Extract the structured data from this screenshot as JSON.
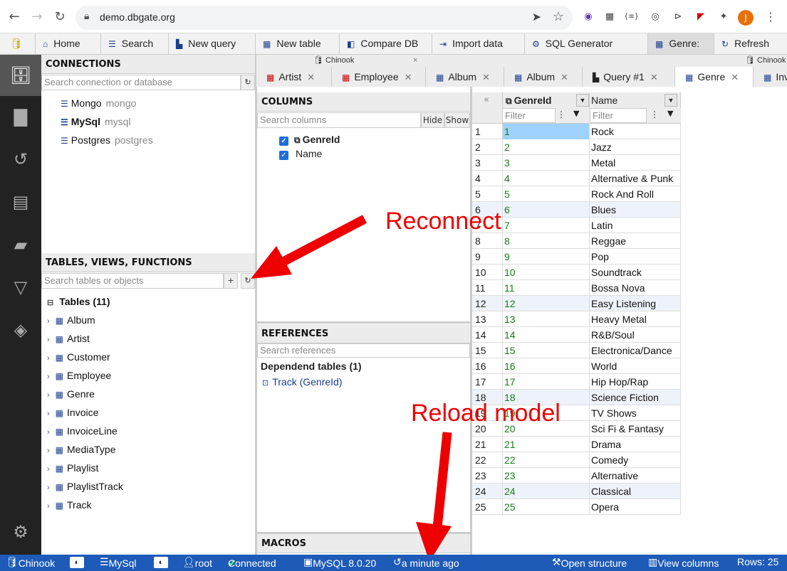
{
  "browser": {
    "url": "demo.dbgate.org",
    "avatar": "J"
  },
  "toolbar": {
    "items": [
      "Home",
      "Search",
      "New query",
      "New table",
      "Compare DB",
      "Import data",
      "SQL Generator",
      "Genre:",
      "Refresh"
    ]
  },
  "connections": {
    "title": "CONNECTIONS",
    "search_placeholder": "Search connection or database",
    "items": [
      {
        "name": "Mongo",
        "sub": "mongo"
      },
      {
        "name": "MySql",
        "sub": "mysql"
      },
      {
        "name": "Postgres",
        "sub": "postgres"
      }
    ]
  },
  "tables_panel": {
    "title": "TABLES, VIEWS, FUNCTIONS",
    "search_placeholder": "Search tables or objects",
    "group_label": "Tables (11)",
    "items": [
      "Album",
      "Artist",
      "Customer",
      "Employee",
      "Genre",
      "Invoice",
      "InvoiceLine",
      "MediaType",
      "Playlist",
      "PlaylistTrack",
      "Track"
    ]
  },
  "tabs": {
    "db_group_1": "Chinook",
    "db_group_2": "Chinook",
    "items": [
      "Artist",
      "Employee",
      "Album",
      "Album",
      "Query #1",
      "Genre",
      "Inv"
    ]
  },
  "columns_panel": {
    "title": "COLUMNS",
    "search_placeholder": "Search columns",
    "hide_label": "Hide",
    "show_label": "Show",
    "items": [
      "GenreId",
      "Name"
    ]
  },
  "references_panel": {
    "title": "REFERENCES",
    "search_placeholder": "Search references",
    "dependent_label": "Dependend tables (1)",
    "ref_item": "Track (GenreId)"
  },
  "macros": {
    "title": "MACROS"
  },
  "grid": {
    "col1": "GenreId",
    "col2": "Name",
    "filter_placeholder": "Filter",
    "rows": [
      [
        1,
        "Rock"
      ],
      [
        2,
        "Jazz"
      ],
      [
        3,
        "Metal"
      ],
      [
        4,
        "Alternative & Punk"
      ],
      [
        5,
        "Rock And Roll"
      ],
      [
        6,
        "Blues"
      ],
      [
        7,
        "Latin"
      ],
      [
        8,
        "Reggae"
      ],
      [
        9,
        "Pop"
      ],
      [
        10,
        "Soundtrack"
      ],
      [
        11,
        "Bossa Nova"
      ],
      [
        12,
        "Easy Listening"
      ],
      [
        13,
        "Heavy Metal"
      ],
      [
        14,
        "R&B/Soul"
      ],
      [
        15,
        "Electronica/Dance"
      ],
      [
        16,
        "World"
      ],
      [
        17,
        "Hip Hop/Rap"
      ],
      [
        18,
        "Science Fiction"
      ],
      [
        19,
        "TV Shows"
      ],
      [
        20,
        "Sci Fi & Fantasy"
      ],
      [
        21,
        "Drama"
      ],
      [
        22,
        "Comedy"
      ],
      [
        23,
        "Alternative"
      ],
      [
        24,
        "Classical"
      ],
      [
        25,
        "Opera"
      ]
    ]
  },
  "status": {
    "db": "Chinook",
    "conn": "MySql",
    "user": "root",
    "state": "Connected",
    "version": "MySQL 8.0.20",
    "time": "a minute ago",
    "open_structure": "Open structure",
    "view_columns": "View columns",
    "rows": "Rows: 25"
  },
  "annotations": {
    "reconnect": "Reconnect",
    "reload": "Reload model"
  },
  "colors": {
    "accent": "#1e5bb8",
    "annotation": "#e00000",
    "sidebar": "#222222"
  }
}
